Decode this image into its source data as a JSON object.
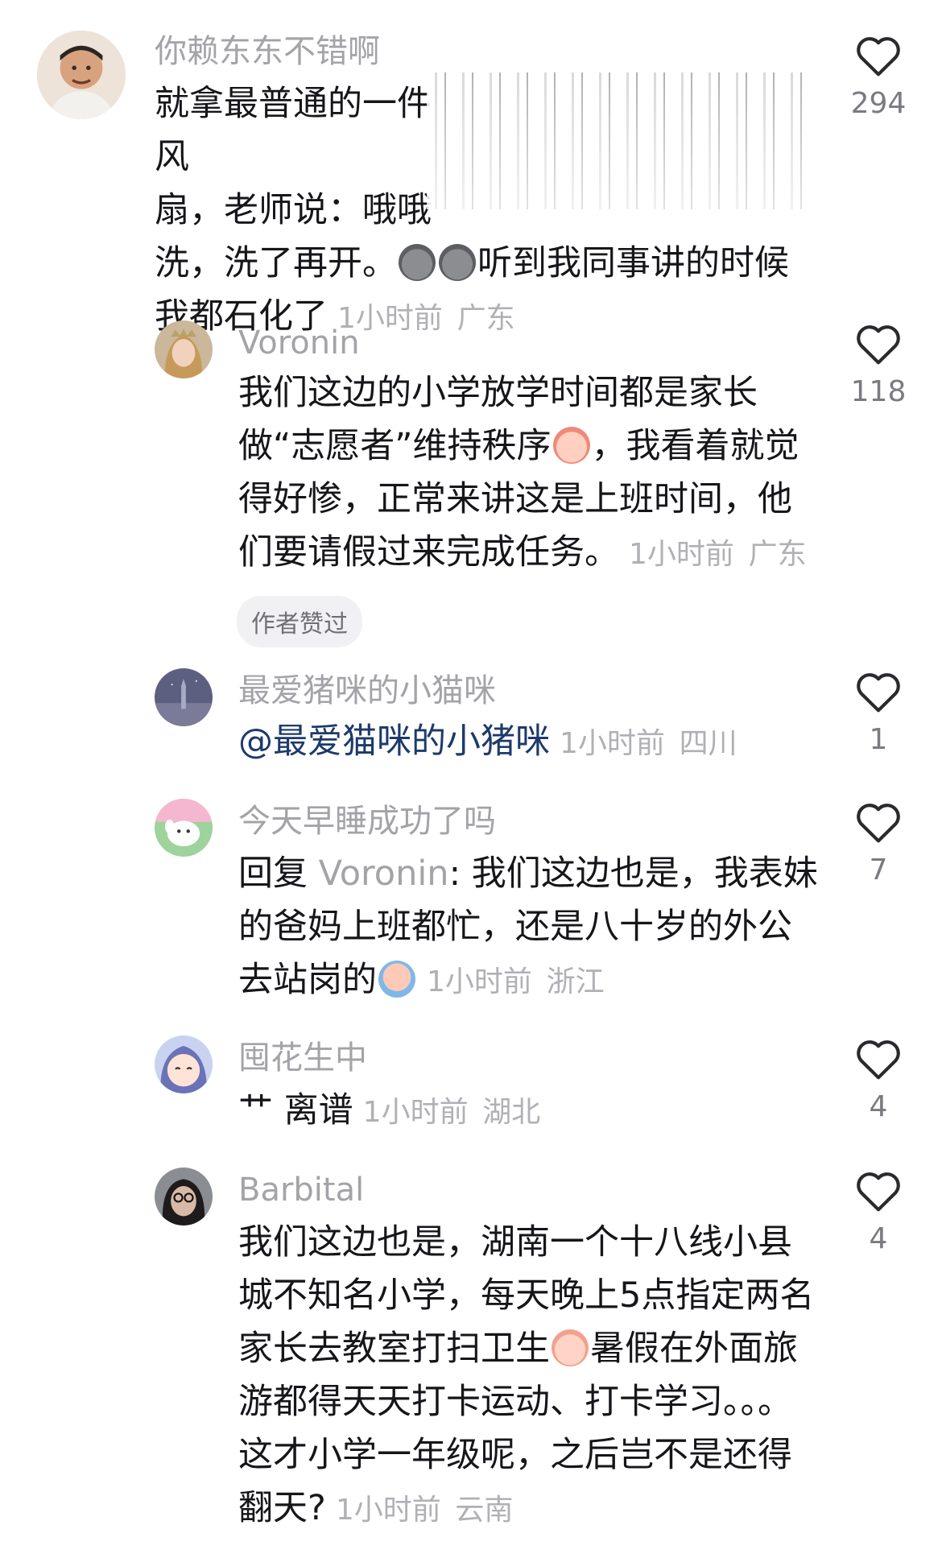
{
  "comments": [
    {
      "name": "你赖东东不错啊",
      "text": "就拿最普通的一件……………………………………风扇，老师说：哦哦……………洗，洗了再开。",
      "text_after": "听到我同事讲的时候我都石化了",
      "line1": "就拿最普通的一件",
      "line1_end": "风",
      "line2": "扇，老师说：哦哦",
      "line3_start": "洗，洗了再开。",
      "line3_end": "听到我同事讲的时候",
      "line4": "我都石化了",
      "time": "1小时前",
      "location": "广东",
      "likes": "294",
      "avatar_icon": "man-avatar"
    },
    {
      "name": "Voronin",
      "text_a": "我们这边的小学放学时间都是家长做“志愿者”维持秩序",
      "text_b": "，我看着就觉得好惨，正常来讲这是上班时间，他们要请假过来完成任务。",
      "time": "1小时前",
      "location": "广东",
      "likes": "118",
      "author_badge": "作者赞过",
      "avatar_icon": "woman-portrait-avatar"
    },
    {
      "name": "最爱猪咪的小猫咪",
      "mention": "@最爱猫咪的小猪咪",
      "time": "1小时前",
      "location": "四川",
      "likes": "1",
      "avatar_icon": "night-sky-avatar"
    },
    {
      "name": "今天早睡成功了吗",
      "reply_prefix": "回复",
      "reply_to": "Voronin",
      "text": ": 我们这边也是，我表妹的爸妈上班都忙，还是八十岁的外公去站岗的",
      "time": "1小时前",
      "location": "浙江",
      "likes": "7",
      "avatar_icon": "cartoon-dog-avatar"
    },
    {
      "name": "囤花生中",
      "text": "艹 离谱",
      "time": "1小时前",
      "location": "湖北",
      "likes": "4",
      "avatar_icon": "anime-girl-avatar"
    },
    {
      "name": "Barbital",
      "text_a": "我们这边也是，湖南一个十八线小县城不知名小学，每天晚上5点指定两名家长去教室打扫卫生",
      "text_b": "暑假在外面旅游都得天天打卡运动、打卡学习。。。这才小学一年级呢，之后岂不是还得翻天?",
      "time": "1小时前",
      "location": "云南",
      "likes": "4",
      "avatar_icon": "woman-glasses-avatar"
    }
  ]
}
